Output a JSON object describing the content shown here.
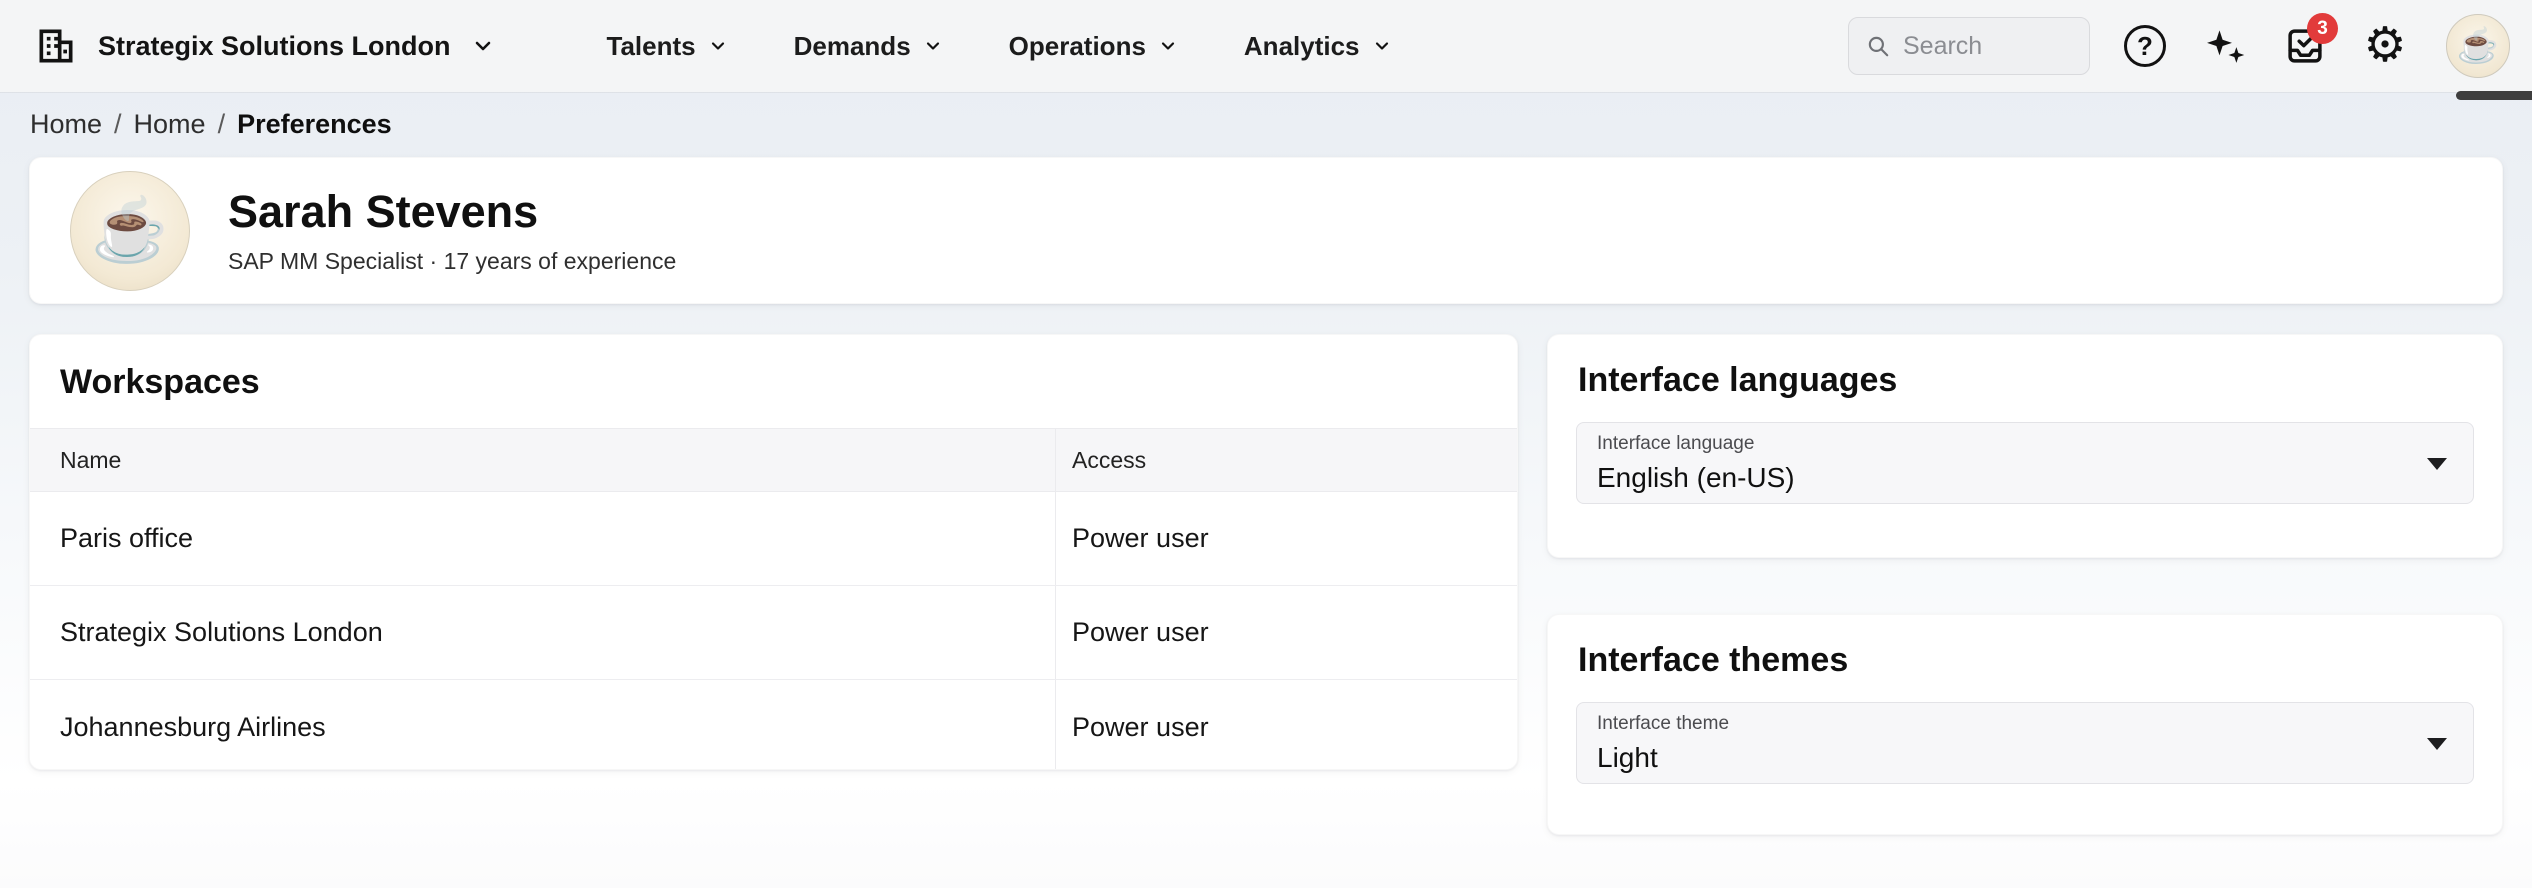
{
  "topbar": {
    "company": "Strategix Solutions London",
    "nav": [
      {
        "label": "Talents"
      },
      {
        "label": "Demands"
      },
      {
        "label": "Operations"
      },
      {
        "label": "Analytics"
      }
    ],
    "search_placeholder": "Search",
    "help_glyph": "?",
    "inbox_badge": "3"
  },
  "breadcrumb": {
    "items": [
      "Home",
      "Home"
    ],
    "separator": "/",
    "current": "Preferences"
  },
  "profile": {
    "name": "Sarah Stevens",
    "subtitle": "SAP MM Specialist · 17 years of experience",
    "avatar_glyph": "☕"
  },
  "workspaces": {
    "title": "Workspaces",
    "columns": [
      "Name",
      "Access"
    ],
    "rows": [
      {
        "name": "Paris office",
        "access": "Power user"
      },
      {
        "name": "Strategix Solutions London",
        "access": "Power user"
      },
      {
        "name": "Johannesburg Airlines",
        "access": "Power user"
      }
    ]
  },
  "languages": {
    "title": "Interface languages",
    "field_label": "Interface language",
    "value": "English (en-US)"
  },
  "themes": {
    "title": "Interface themes",
    "field_label": "Interface theme",
    "value": "Light"
  },
  "colors": {
    "badge_red": "#e23b3b",
    "icon_dark": "#121212",
    "topbar_bg": "#f4f5f6"
  }
}
